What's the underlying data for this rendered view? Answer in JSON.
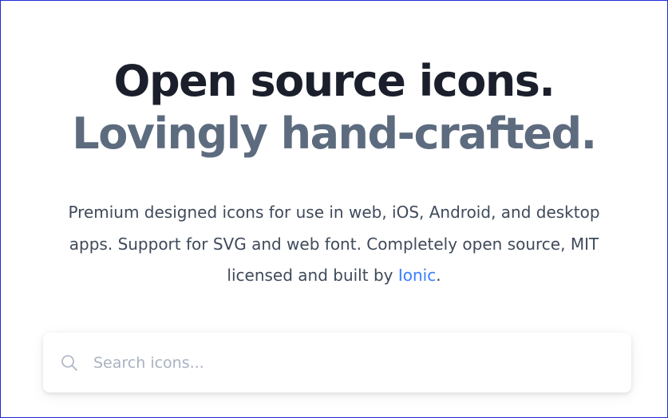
{
  "hero": {
    "title_line1": "Open source icons.",
    "title_line2": "Lovingly hand-crafted.",
    "description_before_link": "Premium designed icons for use in web, iOS, Android, and desktop apps. Support for SVG and web font. Completely open source, MIT licensed and built by ",
    "description_link": "Ionic",
    "description_after_link": "."
  },
  "search": {
    "placeholder": "Search icons...",
    "value": "",
    "icon": "search-icon"
  },
  "colors": {
    "title_dark": "#1a1f2b",
    "title_muted": "#5d6b7f",
    "body_text": "#3f4a5a",
    "link": "#3880ff",
    "placeholder": "#a8b2c0"
  }
}
